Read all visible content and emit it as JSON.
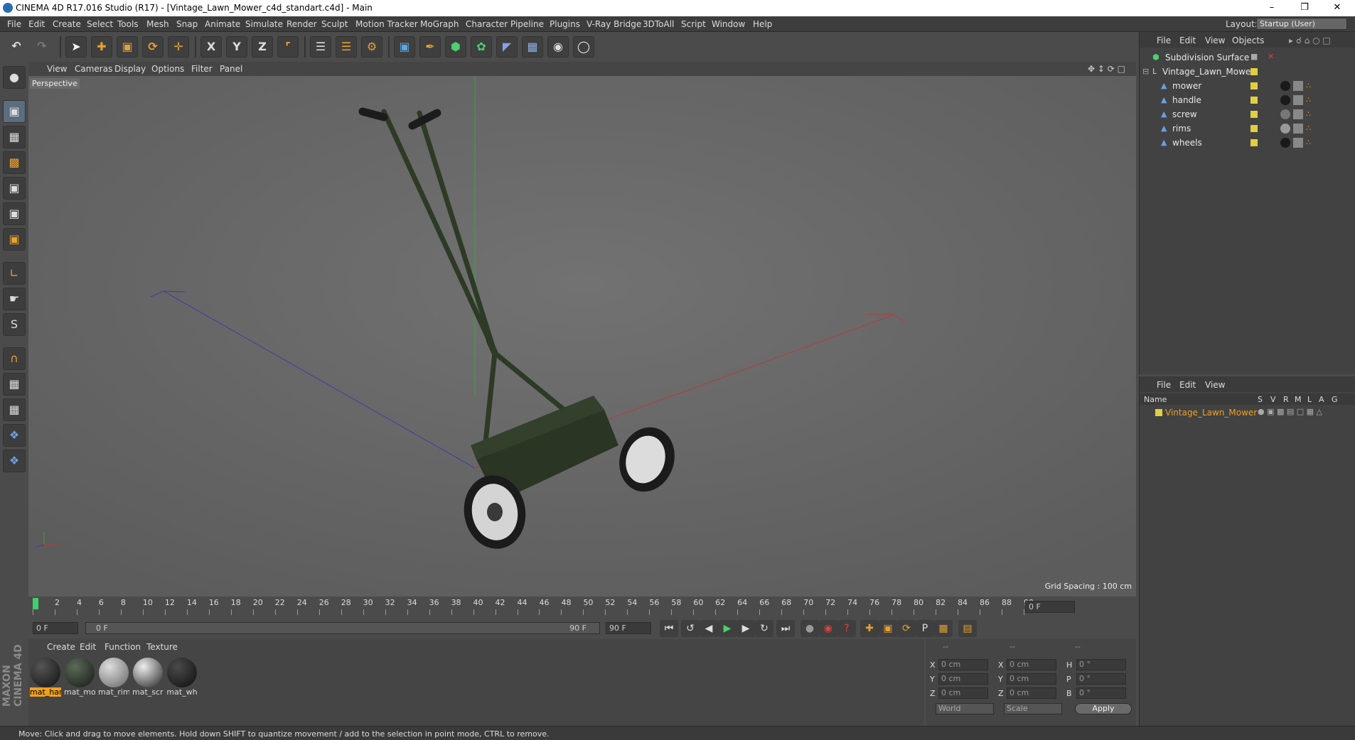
{
  "window": {
    "title": "CINEMA 4D R17.016 Studio (R17) - [Vintage_Lawn_Mower_c4d_standart.c4d] - Main"
  },
  "menu": [
    "File",
    "Edit",
    "Create",
    "Select",
    "Tools",
    "Mesh",
    "Snap",
    "Animate",
    "Simulate",
    "Render",
    "Sculpt",
    "Motion Tracker",
    "MoGraph",
    "Character",
    "Pipeline",
    "Plugins",
    "V-Ray Bridge",
    "3DToAll",
    "Script",
    "Window",
    "Help"
  ],
  "layout": {
    "label": "Layout:",
    "value": "Startup (User)"
  },
  "viewport": {
    "menu": [
      "View",
      "Cameras",
      "Display",
      "Options",
      "Filter",
      "Panel"
    ],
    "label": "Perspective",
    "grid_spacing": "Grid Spacing : 100 cm"
  },
  "timeline": {
    "ticks": [
      "0",
      "2",
      "4",
      "6",
      "8",
      "10",
      "12",
      "14",
      "16",
      "18",
      "20",
      "22",
      "24",
      "26",
      "28",
      "30",
      "32",
      "34",
      "36",
      "38",
      "40",
      "42",
      "44",
      "46",
      "48",
      "50",
      "52",
      "54",
      "56",
      "58",
      "60",
      "62",
      "64",
      "66",
      "68",
      "70",
      "72",
      "74",
      "76",
      "78",
      "80",
      "82",
      "84",
      "86",
      "88",
      "90"
    ],
    "current": "0 F",
    "start": "0 F",
    "range_start": "0 F",
    "range_end": "90 F",
    "end": "90 F"
  },
  "object_manager": {
    "menu": [
      "File",
      "Edit",
      "View",
      "Objects"
    ],
    "objects": [
      {
        "name": "Subdivision Surface"
      },
      {
        "name": "Vintage_Lawn_Mower"
      },
      {
        "name": "mower"
      },
      {
        "name": "handle"
      },
      {
        "name": "screw"
      },
      {
        "name": "rims"
      },
      {
        "name": "wheels"
      }
    ]
  },
  "attribute_manager": {
    "menu": [
      "File",
      "Edit",
      "View"
    ],
    "columns": [
      "Name",
      "S",
      "V",
      "R",
      "M",
      "L",
      "A",
      "G"
    ],
    "row": "Vintage_Lawn_Mower"
  },
  "material_manager": {
    "menu": [
      "Create",
      "Edit",
      "Function",
      "Texture"
    ],
    "materials": [
      {
        "name": "mat_har",
        "color": "#1a1a1a"
      },
      {
        "name": "mat_mo",
        "color": "#2a3a2a"
      },
      {
        "name": "mat_rim",
        "color": "#9a9a9a"
      },
      {
        "name": "mat_scre",
        "color": "#7a7a7a"
      },
      {
        "name": "mat_wh",
        "color": "#222222"
      }
    ]
  },
  "coordinates": {
    "headers": [
      "--",
      "--",
      "--"
    ],
    "rows": [
      {
        "a": "X",
        "av": "0 cm",
        "b": "X",
        "bv": "0 cm",
        "c": "H",
        "cv": "0 °"
      },
      {
        "a": "Y",
        "av": "0 cm",
        "b": "Y",
        "bv": "0 cm",
        "c": "P",
        "cv": "0 °"
      },
      {
        "a": "Z",
        "av": "0 cm",
        "b": "Z",
        "bv": "0 cm",
        "c": "B",
        "cv": "0 °"
      }
    ],
    "mode1": "World",
    "mode2": "Scale",
    "apply": "Apply"
  },
  "brand": "MAXON CINEMA 4D",
  "status": "Move: Click and drag to move elements. Hold down SHIFT to quantize movement / add to the selection in point mode, CTRL to remove."
}
